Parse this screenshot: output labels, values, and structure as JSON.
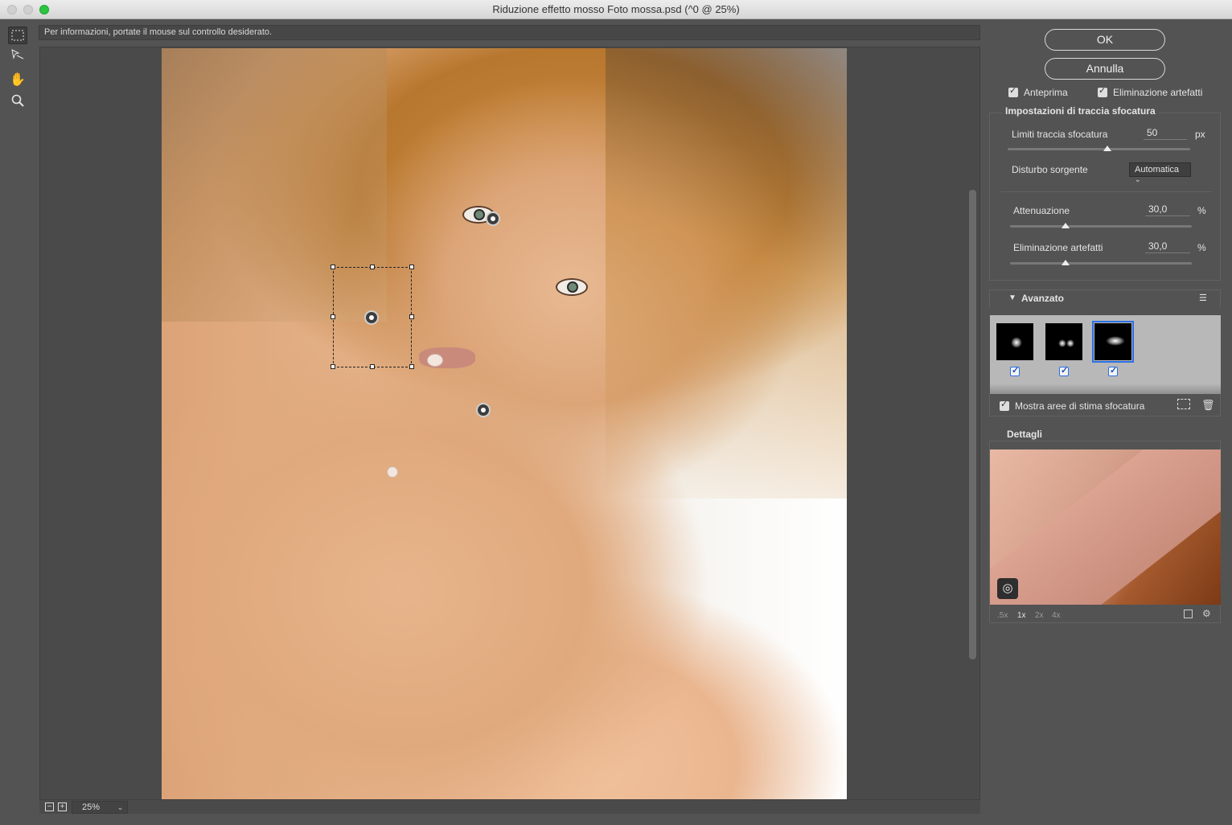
{
  "window": {
    "title": "Riduzione effetto mosso Foto mossa.psd (^0 @ 25%)"
  },
  "infobar": {
    "text": "Per informazioni, portate il mouse sul controllo desiderato."
  },
  "toolbar": {
    "tools": [
      "blur-trace-tool",
      "blur-direction-tool",
      "hand-tool",
      "zoom-tool"
    ]
  },
  "zoom": {
    "value": "25%",
    "minus": "−",
    "plus": "+",
    "dropdown": "⌄"
  },
  "buttons": {
    "ok": "OK",
    "cancel": "Annulla"
  },
  "options": {
    "preview": "Anteprima",
    "artifact_removal": "Eliminazione artefatti"
  },
  "blur_trace": {
    "heading": "Impostazioni di traccia sfocatura",
    "bounds_label": "Limiti traccia sfocatura",
    "bounds_value": "50",
    "bounds_unit": "px",
    "bounds_slider": 0.55,
    "noise_label": "Disturbo sorgente",
    "noise_value": "Automatica",
    "smoothing_label": "Attenuazione",
    "smoothing_value": "30,0",
    "smoothing_unit": "%",
    "smoothing_slider": 0.3,
    "artifact_label": "Eliminazione artefatti",
    "artifact_value": "30,0",
    "artifact_unit": "%",
    "artifact_slider": 0.3
  },
  "advanced": {
    "heading": "Avanzato",
    "show_areas": "Mostra aree di stima sfocatura",
    "kernels": [
      {
        "checked": true,
        "selected": false
      },
      {
        "checked": true,
        "selected": false
      },
      {
        "checked": true,
        "selected": true
      }
    ]
  },
  "details": {
    "heading": "Dettagli",
    "zoom_levels": [
      ".5x",
      "1x",
      "2x",
      "4x"
    ],
    "current_zoom": "1x"
  },
  "colors": {
    "accent": "#2b6fe6",
    "panel": "#535353"
  }
}
